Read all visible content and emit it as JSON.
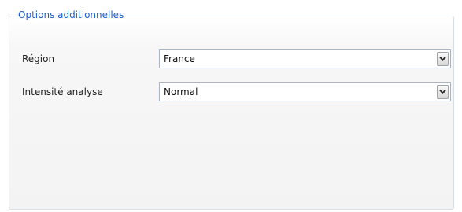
{
  "groupbox": {
    "title": "Options additionnelles"
  },
  "fields": [
    {
      "label": "Région",
      "value": "France"
    },
    {
      "label": "Intensité analyse",
      "value": "Normal"
    }
  ],
  "icons": {
    "dropdown": "chevron-down-icon"
  },
  "colors": {
    "legend_text": "#1a5fd0",
    "border": "#a9b5c2"
  }
}
